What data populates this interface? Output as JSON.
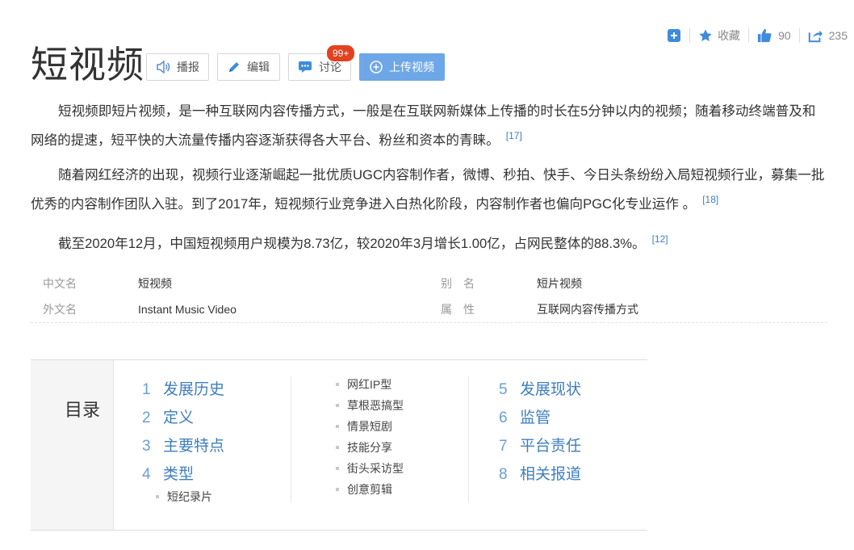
{
  "top_actions": {
    "add_icon": "plus-square-icon",
    "favorite_label": "收藏",
    "like_count": "90",
    "share_count": "235"
  },
  "title": "短视频",
  "toolbar": {
    "broadcast_label": "播报",
    "edit_label": "编辑",
    "discuss_label": "讨论",
    "discuss_badge": "99+",
    "upload_label": "上传视频"
  },
  "paragraphs": [
    {
      "text": "短视频即短片视频，是一种互联网内容传播方式，一般是在互联网新媒体上传播的时长在5分钟以内的视频；随着移动终端普及和网络的提速，短平快的大流量传播内容逐渐获得各大平台、粉丝和资本的青睐。",
      "ref": "[17]"
    },
    {
      "text": "随着网红经济的出现，视频行业逐渐崛起一批优质UGC内容制作者，微博、秒拍、快手、今日头条纷纷入局短视频行业，募集一批优秀的内容制作团队入驻。到了2017年，短视频行业竞争进入白热化阶段，内容制作者也偏向PGC化专业运作  。",
      "ref": "[18]"
    },
    {
      "text": "截至2020年12月，中国短视频用户规模为8.73亿，较2020年3月增长1.00亿，占网民整体的88.3%。",
      "ref": "[12]"
    }
  ],
  "basic_info": {
    "row1": {
      "k1": "中文名",
      "v1": "短视频",
      "k2": "别　名",
      "v2": "短片视频"
    },
    "row2": {
      "k1": "外文名",
      "v1": "Instant Music Video",
      "k2": "属　性",
      "v2": "互联网内容传播方式"
    }
  },
  "catalog": {
    "title": "目录",
    "col1": [
      {
        "num": "1",
        "label": "发展历史"
      },
      {
        "num": "2",
        "label": "定义"
      },
      {
        "num": "3",
        "label": "主要特点"
      },
      {
        "num": "4",
        "label": "类型"
      }
    ],
    "col1_sub": [
      "短纪录片"
    ],
    "col2_sub": [
      "网红IP型",
      "草根恶搞型",
      "情景短剧",
      "技能分享",
      "街头采访型",
      "创意剪辑"
    ],
    "col3": [
      {
        "num": "5",
        "label": "发展现状"
      },
      {
        "num": "6",
        "label": "监管"
      },
      {
        "num": "7",
        "label": "平台责任"
      },
      {
        "num": "8",
        "label": "相关报道"
      }
    ]
  },
  "colors": {
    "accent": "#3f7ebf",
    "primary_button": "#6ea7e8",
    "badge": "#e3411f"
  }
}
